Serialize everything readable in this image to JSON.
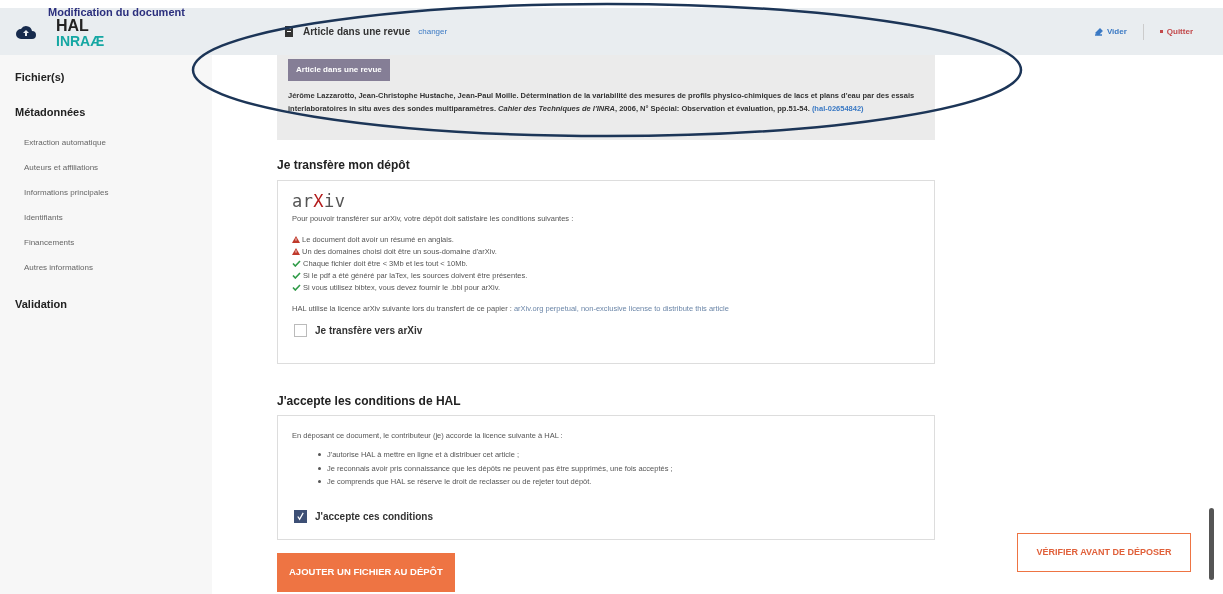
{
  "header": {
    "title": "Modification du document",
    "logo_top": "HAL",
    "logo_bottom": "INRAÆ",
    "doc_type": "Article dans une revue",
    "change_link": "changer",
    "actions": [
      {
        "kind": "clear",
        "label": "Vider"
      },
      {
        "kind": "quit",
        "label": "Quitter"
      }
    ]
  },
  "sidebar": {
    "sections": [
      {
        "label": "Fichier(s)"
      },
      {
        "label": "Métadonnées",
        "children": [
          {
            "label": "Extraction automatique"
          },
          {
            "label": "Auteurs et affiliations"
          },
          {
            "label": "Informations principales"
          },
          {
            "label": "Identifiants"
          },
          {
            "label": "Financements"
          },
          {
            "label": "Autres informations"
          }
        ]
      },
      {
        "label": "Validation"
      }
    ]
  },
  "citation": {
    "badge": "Article dans une revue",
    "text": "Jérôme Lazzarotto, Jean-Christophe Hustache, Jean-Paul Moille. Détermination de la variabilité des mesures de profils physico-chimiques de lacs et plans d'eau par des essais interlaboratoires in situ aves des sondes multiparamètres. *Cahier des Techniques de l'INRA*, 2006, N° Spécial: Observation et évaluation, pp.51-54.",
    "link": "(hal-02654842)"
  },
  "transfer": {
    "heading": "Je transfère mon dépôt",
    "logo_parts": [
      "ar",
      "X",
      "iv"
    ],
    "intro": "Pour pouvoir transférer sur arXiv, votre dépôt doit satisfaire les conditions suivantes :",
    "conditions": [
      {
        "kind": "warning",
        "text": "Le document doit avoir un résumé en anglais."
      },
      {
        "kind": "warning",
        "text": "Un des domaines choisi doit être un sous-domaine d'arXiv."
      },
      {
        "kind": "ok",
        "text": "Chaque fichier doit être < 3Mb et les tout < 10Mb."
      },
      {
        "kind": "ok",
        "text": "Si le pdf a été généré par laTex, les sources doivent être présentes."
      },
      {
        "kind": "ok",
        "text": "Si vous utilisez bibtex, vous devez fournir le .bbl pour arXiv."
      }
    ],
    "license_text": "HAL utilise la licence arXiv suivante lors du transfert de ce papier :",
    "license_link": "arXiv.org perpetual, non-exclusive license to distribute this article",
    "checkbox": {
      "label": "Je transfère vers arXiv",
      "checked": false
    }
  },
  "conditions": {
    "heading": "J'accepte les conditions de HAL",
    "intro": "En déposant ce document, le contributeur (je) accorde la licence suivante à HAL :",
    "items": [
      "J'autorise HAL à mettre en ligne et à distribuer cet article ;",
      "Je reconnais avoir pris connaissance que les dépôts ne peuvent pas être supprimés, une fois acceptés ;",
      "Je comprends que HAL se réserve le droit de reclasser ou de rejeter tout dépôt."
    ],
    "checkbox": {
      "label": "J'accepte ces conditions",
      "checked": true
    }
  },
  "add_file_button": "AJOUTER UN FICHIER AU DÉPÔT",
  "verify_button": "VÉRIFIER AVANT DE DÉPOSER"
}
